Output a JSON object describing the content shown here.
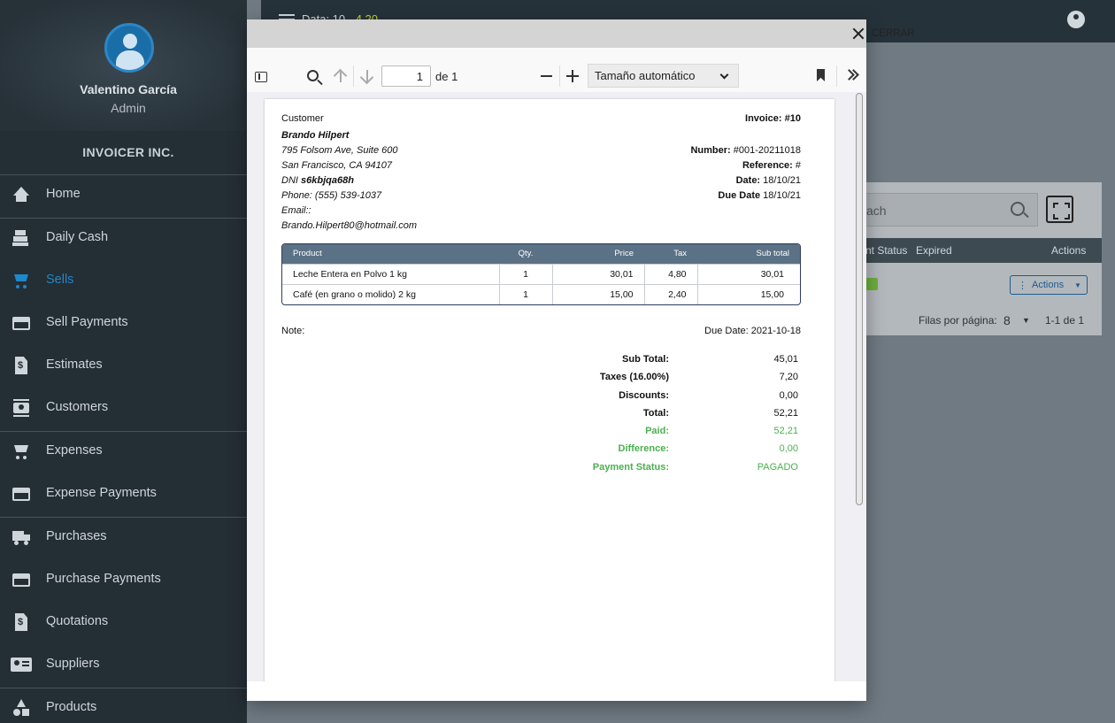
{
  "topbar": {
    "title_prefix": "Data: 10 -",
    "title_amount": "4.20"
  },
  "background_table": {
    "search_placeholder": "ach",
    "columns": [
      "nt Status",
      "Expired",
      "Actions"
    ],
    "actions_label": "Actions",
    "rows_per_page_label": "Filas por página:",
    "rows_per_page_value": "8",
    "range": "1-1 de 1"
  },
  "profile": {
    "name": "Valentino García",
    "role": "Admin",
    "company": "INVOICER INC."
  },
  "sidebar": {
    "items": [
      {
        "label": "Home",
        "icon": "home-icon"
      },
      {
        "label": "Daily Cash",
        "icon": "cash-register-icon"
      },
      {
        "label": "Sells",
        "icon": "cart-icon",
        "active": true
      },
      {
        "label": "Sell Payments",
        "icon": "credit-card-icon"
      },
      {
        "label": "Estimates",
        "icon": "dollar-file-icon"
      },
      {
        "label": "Customers",
        "icon": "contacts-icon"
      },
      {
        "label": "Expenses",
        "icon": "cart-icon"
      },
      {
        "label": "Expense Payments",
        "icon": "credit-card-icon"
      },
      {
        "label": "Purchases",
        "icon": "truck-icon"
      },
      {
        "label": "Purchase Payments",
        "icon": "credit-card-icon"
      },
      {
        "label": "Quotations",
        "icon": "dollar-file-icon"
      },
      {
        "label": "Suppliers",
        "icon": "contact-card-icon"
      },
      {
        "label": "Products",
        "icon": "shapes-icon"
      }
    ]
  },
  "modal": {
    "close_label": "CERRAR",
    "toolbar": {
      "page_value": "1",
      "page_of": "de 1",
      "zoom": "Tamaño automático"
    }
  },
  "invoice": {
    "customer_label": "Customer",
    "customer_name": "Brando Hilpert",
    "address1": "795 Folsom Ave, Suite 600",
    "address2": "San Francisco, CA 94107",
    "dni_label": "DNI",
    "dni": "s6kbjqa68h",
    "phone": "Phone: (555) 539-1037",
    "email_label": "Email::",
    "email": "Brando.Hilpert80@hotmail.com",
    "title": "Invoice: #10",
    "number_label": "Number:",
    "number": "#001-20211018",
    "reference_label": "Reference:",
    "reference": "#",
    "date_label": "Date:",
    "date": "18/10/21",
    "due_label": "Due Date",
    "due": "18/10/21",
    "columns": [
      "Product",
      "Qty.",
      "Price",
      "Tax",
      "Sub total"
    ],
    "items": [
      {
        "product": "Leche Entera en Polvo 1 kg",
        "qty": "1",
        "price": "30,01",
        "tax": "4,80",
        "subtotal": "30,01"
      },
      {
        "product": "Café (en grano o molido) 2 kg",
        "qty": "1",
        "price": "15,00",
        "tax": "2,40",
        "subtotal": "15,00"
      }
    ],
    "note_label": "Note:",
    "due_date_text": "Due Date: 2021-10-18",
    "totals": [
      {
        "label": "Sub Total:",
        "value": "45,01"
      },
      {
        "label": "Taxes (16.00%)",
        "value": "7,20"
      },
      {
        "label": "Discounts:",
        "value": "0,00"
      },
      {
        "label": "Total:",
        "value": "52,21"
      },
      {
        "label": "Paid:",
        "value": "52,21",
        "green": true
      },
      {
        "label": "Difference:",
        "value": "0,00",
        "green": true
      },
      {
        "label": "Payment Status:",
        "value": "PAGADO",
        "green": true
      }
    ]
  }
}
